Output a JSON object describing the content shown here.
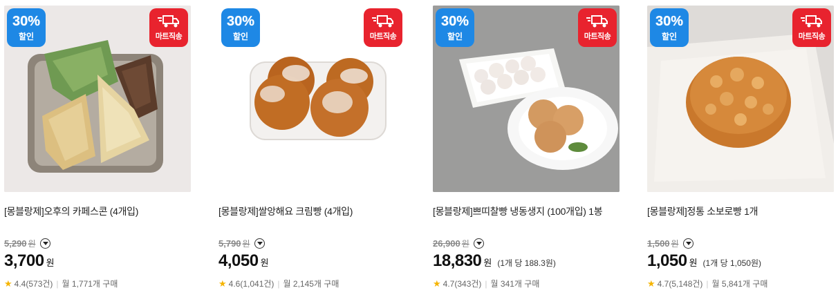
{
  "products": [
    {
      "discount": "30%",
      "discount_label": "할인",
      "delivery_label": "마트직송",
      "title": "[몽블랑제]오후의 카페스콘 (4개입)",
      "original_price": "5,290",
      "currency_strike": "원",
      "price": "3,700",
      "currency": "원",
      "unit_price": "",
      "rating": "4.4",
      "reviews": "(573건)",
      "monthly_sales": "월 1,771개 구매"
    },
    {
      "discount": "30%",
      "discount_label": "할인",
      "delivery_label": "마트직송",
      "title": "[몽블랑제]쌀앙해요 크림빵 (4개입)",
      "original_price": "5,790",
      "currency_strike": "원",
      "price": "4,050",
      "currency": "원",
      "unit_price": "",
      "rating": "4.6",
      "reviews": "(1,041건)",
      "monthly_sales": "월 2,145개 구매"
    },
    {
      "discount": "30%",
      "discount_label": "할인",
      "delivery_label": "마트직송",
      "title": "[몽블랑제]쁘띠찰빵 냉동생지 (100개입) 1봉",
      "original_price": "26,900",
      "currency_strike": "원",
      "price": "18,830",
      "currency": "원",
      "unit_price": "(1개 당 188.3원)",
      "rating": "4.7",
      "reviews": "(343건)",
      "monthly_sales": "월 341개 구매"
    },
    {
      "discount": "30%",
      "discount_label": "할인",
      "delivery_label": "마트직송",
      "title": "[몽블랑제]정통 소보로빵 1개",
      "original_price": "1,500",
      "currency_strike": "원",
      "price": "1,050",
      "currency": "원",
      "unit_price": "(1개 당 1,050원)",
      "rating": "4.7",
      "reviews": "(5,148건)",
      "monthly_sales": "월 5,841개 구매"
    }
  ],
  "icons": {
    "discount_badge_color": "#1e88e5",
    "mart_badge_color": "#e8232e",
    "star_color": "#f5b400",
    "truck": "truck-icon",
    "star": "star-icon",
    "dropdown": "chevron-down-icon"
  }
}
